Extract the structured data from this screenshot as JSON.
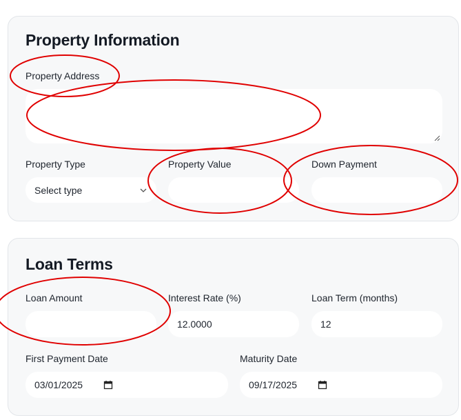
{
  "property": {
    "title": "Property Information",
    "address": {
      "label": "Property Address",
      "value": ""
    },
    "type": {
      "label": "Property Type",
      "selected": "Select type"
    },
    "value": {
      "label": "Property Value",
      "value": ""
    },
    "down_payment": {
      "label": "Down Payment",
      "value": ""
    }
  },
  "loan": {
    "title": "Loan Terms",
    "amount": {
      "label": "Loan Amount",
      "value": ""
    },
    "rate": {
      "label": "Interest Rate (%)",
      "value": "12.0000"
    },
    "term": {
      "label": "Loan Term (months)",
      "value": "12"
    },
    "first_payment": {
      "label": "First Payment Date",
      "value": "03/01/2025"
    },
    "maturity": {
      "label": "Maturity Date",
      "value": "09/17/2025"
    }
  },
  "annotation_color": "#e00000"
}
